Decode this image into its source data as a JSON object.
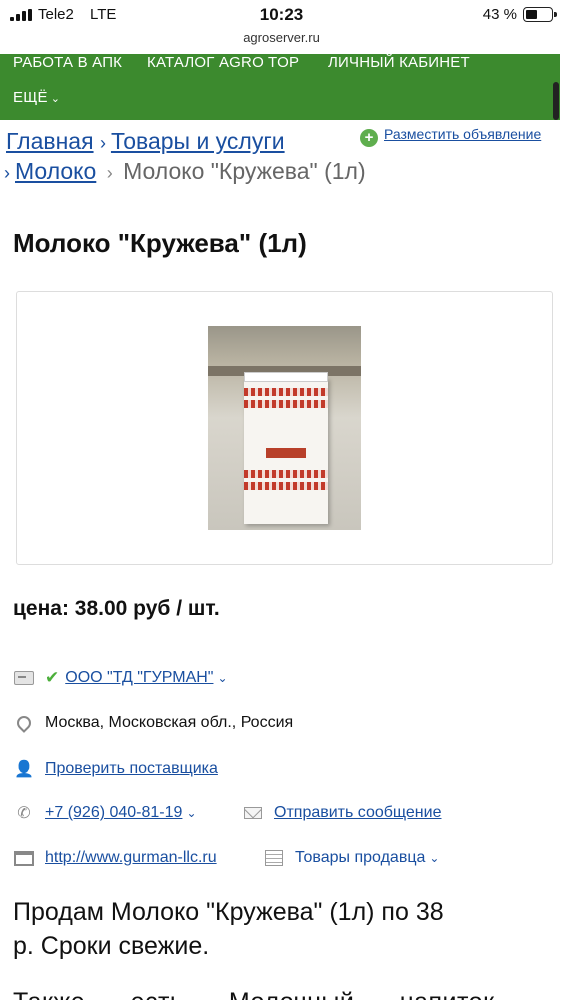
{
  "status_bar": {
    "carrier": "Tele2",
    "network": "LTE",
    "time": "10:23",
    "battery": "43 %",
    "battery_level": 0.43,
    "url": "agroserver.ru"
  },
  "nav": {
    "items": [
      "РАБОТА В АПК",
      "КАТАЛОГ AGRO TOP",
      "ЛИЧНЫЙ КАБИНЕТ",
      "ЕЩЁ"
    ]
  },
  "breadcrumb": {
    "home": "Главная",
    "goods": "Товары и услуги",
    "category": "Молоко",
    "current": "Молоко \"Кружева\" (1л)"
  },
  "post_ad": "Разместить объявление",
  "product": {
    "title": "Молоко \"Кружева\" (1л)",
    "price": "цена: 38.00 руб / шт."
  },
  "seller": {
    "company": "ООО \"ТД \"ГУРМАН\"",
    "location": "Москва, Московская обл., Россия",
    "check_supplier": "Проверить поставщика",
    "phone": "+7 (926) 040-81-19",
    "send_message": "Отправить сообщение",
    "website": "http://www.gurman-llc.ru",
    "seller_goods": "Товары продавца"
  },
  "description": {
    "line1": "Продам Молоко \"Кружева\" (1л) по 38",
    "line1b": "р. Сроки свежие.",
    "line2": "Также есть Молочный напиток"
  },
  "icons": {
    "signal": "signal-icon",
    "battery": "battery-icon",
    "verified": "check-icon",
    "location": "pin-icon",
    "check": "user-search-icon",
    "phone": "phone-icon",
    "message": "envelope-icon",
    "website": "window-icon",
    "goods": "list-icon",
    "add": "plus-icon"
  },
  "colors": {
    "nav_green": "#3c8a2e",
    "link_blue": "#1a4fa0",
    "check_green": "#4caf3b"
  }
}
